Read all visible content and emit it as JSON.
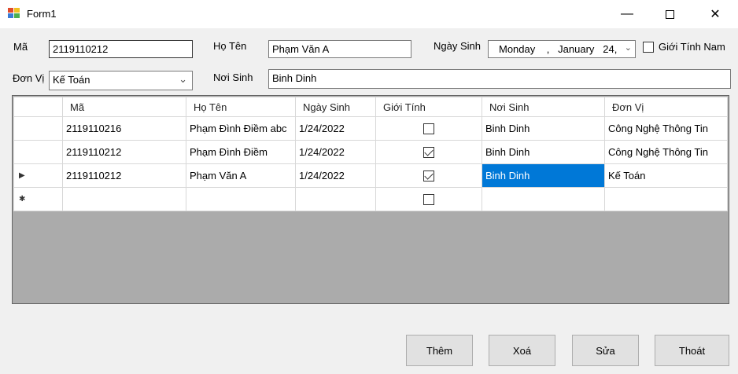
{
  "window": {
    "title": "Form1"
  },
  "form": {
    "ma_label": "Mã",
    "ma_value": "2119110212",
    "hoten_label": "Họ Tên",
    "hoten_value": "Phạm Văn A",
    "ngaysinh_label": "Ngày Sinh",
    "ngaysinh_value": "Monday    ,   January   24,",
    "gioitinh_label": "Giới Tính Nam",
    "gioitinh_checked": false,
    "donvi_label": "Đơn Vị",
    "donvi_value": "Kế Toán",
    "noisinh_label": "Nơi Sinh",
    "noisinh_value": "Binh Dinh"
  },
  "grid": {
    "columns": [
      "Mã",
      "Họ Tên",
      "Ngày Sinh",
      "Giới Tính",
      "Nơi Sinh",
      "Đơn Vị"
    ],
    "rows": [
      {
        "ma": "2119110216",
        "hoten": "Phạm Đình Điềm abc",
        "ngaysinh": "1/24/2022",
        "gioitinh": false,
        "noisinh": "Binh Dinh",
        "donvi": "Công Nghệ Thông Tin"
      },
      {
        "ma": "2119110212",
        "hoten": "Phạm Đình Điềm",
        "ngaysinh": "1/24/2022",
        "gioitinh": true,
        "noisinh": "Binh Dinh",
        "donvi": "Công Nghệ Thông Tin"
      },
      {
        "ma": "2119110212",
        "hoten": "Phạm Văn A",
        "ngaysinh": "1/24/2022",
        "gioitinh": true,
        "noisinh": "Binh Dinh",
        "donvi": "Kế Toán"
      }
    ],
    "current_row_marker": "▶",
    "new_row_marker": "✱"
  },
  "buttons": {
    "them": "Thêm",
    "xoa": "Xoá",
    "sua": "Sửa",
    "thoat": "Thoát"
  }
}
